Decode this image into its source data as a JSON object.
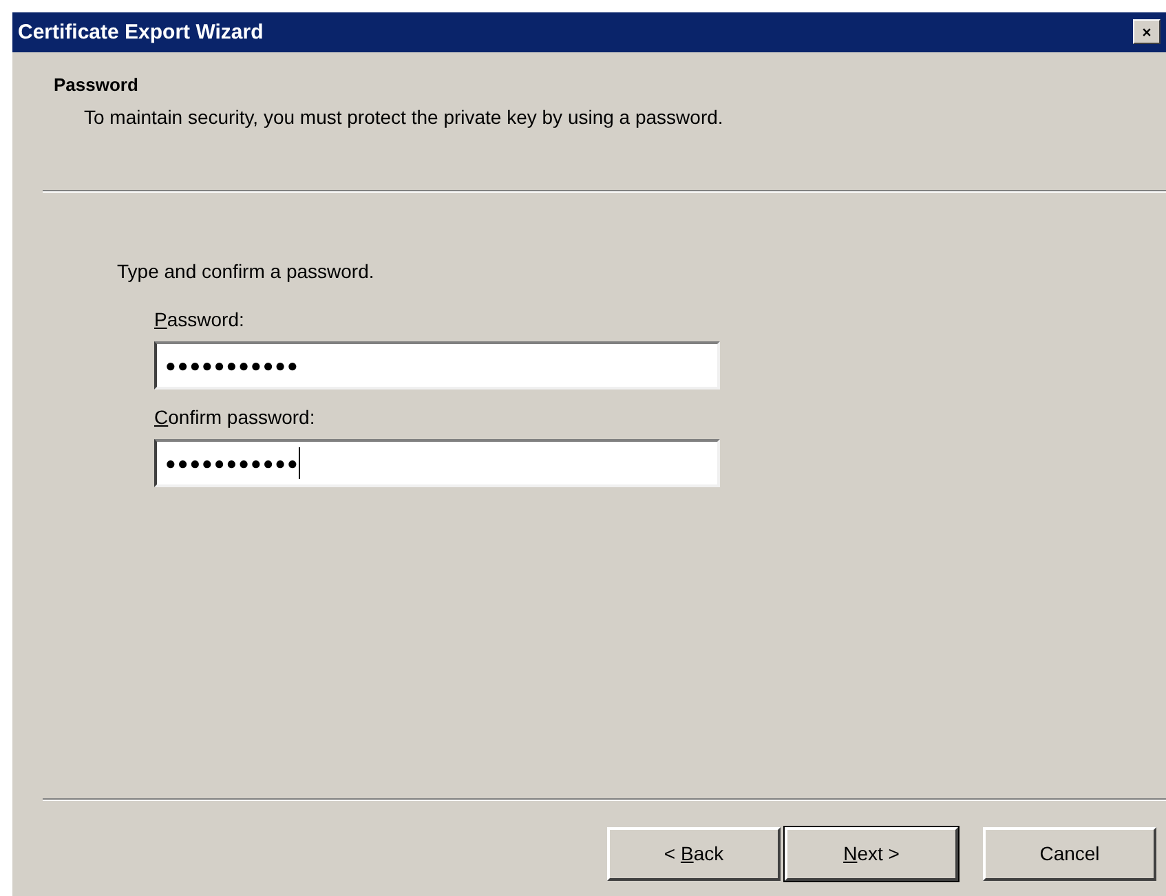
{
  "window": {
    "title": "Certificate Export Wizard"
  },
  "header": {
    "title": "Password",
    "subtitle": "To maintain security, you must protect the private key by using a password."
  },
  "instruction": "Type and confirm a password.",
  "fields": [
    {
      "access_key": "P",
      "label_after": "assword:",
      "value": "●●●●●●●●●●●",
      "focused": false
    },
    {
      "access_key": "C",
      "label_after": "onfirm password:",
      "value": "●●●●●●●●●●●",
      "focused": true
    }
  ],
  "buttons": [
    {
      "label_before": "< ",
      "access_key": "B",
      "label_after": "ack",
      "default": false
    },
    {
      "access_key": "N",
      "label_after": "ext >",
      "default": true
    },
    {
      "label": "Cancel",
      "default": false
    }
  ]
}
